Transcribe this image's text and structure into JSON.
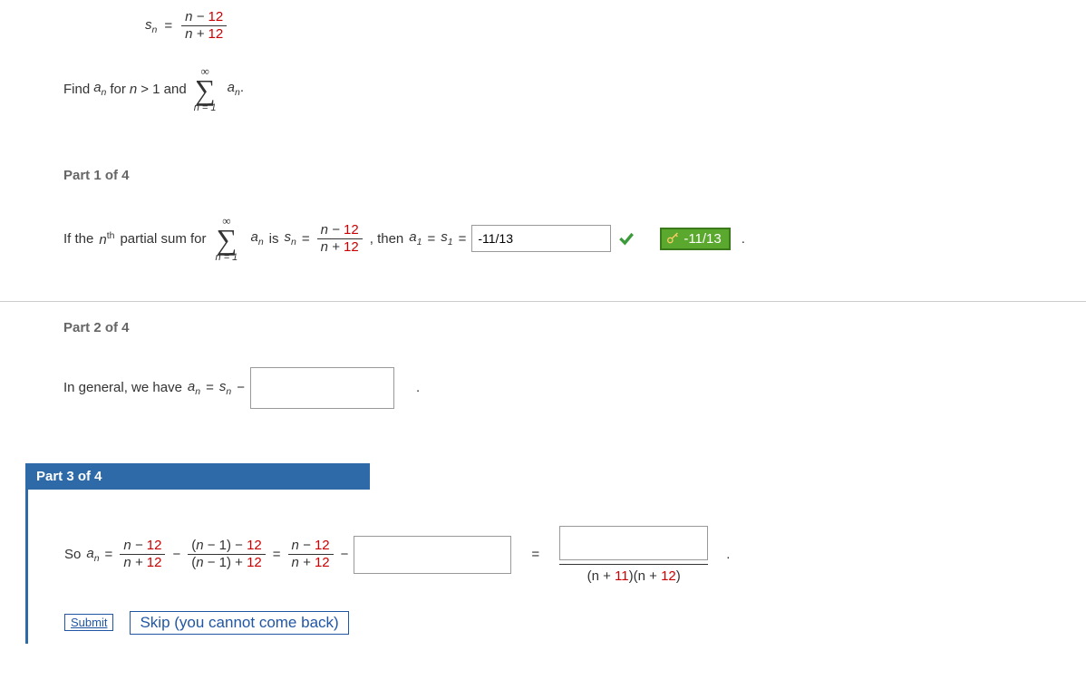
{
  "problem": {
    "sn_var": "s",
    "sn_sub": "n",
    "eq": "=",
    "frac_num_pre": "n − ",
    "frac_num_red": "12",
    "frac_den_pre": "n + ",
    "frac_den_red": "12",
    "find_text_pre": "Find ",
    "find_a": "a",
    "find_a_sub": "n",
    "find_text_mid": " for ",
    "find_n": "n",
    "find_text_gt": " > 1 and ",
    "sigma_top": "∞",
    "sigma_bot": "n = 1",
    "sigma_term_a": "a",
    "sigma_term_sub": "n",
    "period": "."
  },
  "part1": {
    "label": "Part 1 of 4",
    "text_pre": "If the ",
    "nth_n": "n",
    "nth_th": "th",
    "text_partial": " partial sum for ",
    "is_text": " is  ",
    "sn_s": "s",
    "sn_n": "n",
    "eq": " = ",
    "comma_then": ",  then  ",
    "a1_a": "a",
    "a1_1": "1",
    "s1_s": "s",
    "s1_1": "1",
    "answer_value": "-11/13",
    "key_answer": "-11/13"
  },
  "part2": {
    "label": "Part 2 of 4",
    "text_pre": "In general, we have  ",
    "an_a": "a",
    "an_n": "n",
    "eq": " = ",
    "sn_s": "s",
    "sn_n": "n",
    "minus": " − "
  },
  "part3": {
    "label": "Part 3 of 4",
    "so_text": "So  ",
    "an_a": "a",
    "an_n": "n",
    "eq": " = ",
    "f1_num_pre": "n − ",
    "f1_num_red": "12",
    "f1_den_pre": "n + ",
    "f1_den_red": "12",
    "minus": " − ",
    "f2_num_pre": "(n − 1) − ",
    "f2_num_red": "12",
    "f2_den_pre": "(n − 1) + ",
    "f2_den_red": "12",
    "eq2": " = ",
    "f3_num_pre": "n − ",
    "f3_num_red": "12",
    "f3_den_pre": "n + ",
    "f3_den_red": "12",
    "eq3": "=",
    "result_den_pre": "(n + ",
    "result_den_r1": "11",
    "result_den_mid": ")(n + ",
    "result_den_r2": "12",
    "result_den_post": ")"
  },
  "buttons": {
    "submit": "Submit",
    "skip": "Skip (you cannot come back)"
  }
}
